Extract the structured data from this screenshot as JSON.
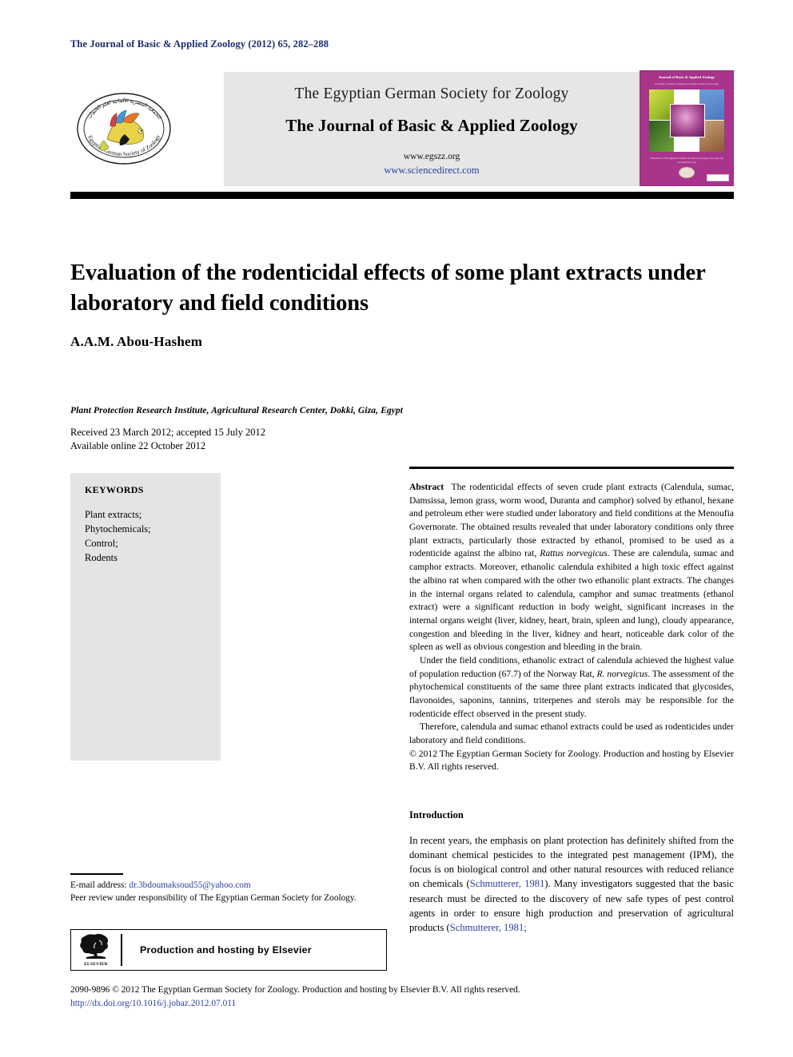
{
  "running_head": "The Journal of Basic & Applied Zoology (2012) 65, 282–288",
  "masthead": {
    "society_name": "The Egyptian German Society for Zoology",
    "journal_name": "The Journal of Basic & Applied Zoology",
    "society_url": "www.egszz.org",
    "sciencedirect_url": "www.sciencedirect.com",
    "seal_alt": "Egyptian German Society of Zoology seal",
    "cover": {
      "title": "Journal of Basic & Applied Zoology",
      "subtitle": "Formerly: Journal of Egyptian German Society of Zoology",
      "footer": "Published by\nThe Egyptian German Society for Zoology\nwww.egsz.org\nwww.elsevier.com"
    }
  },
  "article": {
    "title": "Evaluation of the rodenticidal effects of some plant extracts under laboratory and field conditions",
    "authors": "A.A.M. Abou-Hashem",
    "affiliation": "Plant Protection Research Institute, Agricultural Research Center, Dokki, Giza, Egypt",
    "received": "Received 23 March 2012; accepted 15 July 2012",
    "available": "Available online 22 October 2012"
  },
  "keywords": {
    "heading": "KEYWORDS",
    "items": [
      "Plant extracts;",
      "Phytochemicals;",
      "Control;",
      "Rodents"
    ]
  },
  "abstract": {
    "label": "Abstract",
    "paragraph1_a": "The rodenticidal effects of seven crude plant extracts (Calendula, sumac, Damsissa, lemon grass, worm wood, Duranta and camphor) solved by ethanol, hexane and petroleum ether were studied under laboratory and field conditions at the Menoufia Governorate. The obtained results revealed that under laboratory conditions only three plant extracts, particularly those extracted by ethanol, promised to be used as a rodenticide against the albino rat, ",
    "paragraph1_species": "Rattus norvegicus",
    "paragraph1_b": ". These are calendula, sumac and camphor extracts. Moreover, ethanolic calendula exhibited a high toxic effect against the albino rat when compared with the other two ethanolic plant extracts. The changes in the internal organs related to calendula, camphor and sumac treatments (ethanol extract) were a significant reduction in body weight, significant increases in the internal organs weight (liver, kidney, heart, brain, spleen and lung), cloudy appearance, congestion and bleeding in the liver, kidney and heart, noticeable dark color of the spleen as well as obvious congestion and bleeding in the brain.",
    "paragraph2_a": "Under the field conditions, ethanolic extract of calendula achieved the highest value of population reduction (67.7) of the Norway Rat, ",
    "paragraph2_species": "R. norvegicus",
    "paragraph2_b": ". The assessment of the phytochemical constituents of the same three plant extracts indicated that glycosides, flavonoides, saponins, tannins, triterpenes and sterols may be responsible for the rodenticide effect observed in the present study.",
    "paragraph3": "Therefore, calendula and sumac ethanol extracts could be used as rodenticides under laboratory and field conditions.",
    "copyright": "© 2012 The Egyptian German Society for Zoology. Production and hosting by Elsevier B.V. All rights reserved."
  },
  "introduction": {
    "heading": "Introduction",
    "text_a": "In recent years, the emphasis on plant protection has definitely shifted from the dominant chemical pesticides to the integrated pest management (IPM), the focus is on biological control and other natural resources with reduced reliance on chemicals (",
    "citation1": "Schmutterer, 1981",
    "text_b": "). Many investigators suggested that the basic research must be directed to the discovery of new safe types of pest control agents in order to ensure high production and preservation of agricultural products (",
    "citation2": "Schmutterer, 1981;"
  },
  "footnotes": {
    "email_label": "E-mail address:",
    "email": "dr.3bdoumaksoud55@yahoo.com",
    "peer_review": "Peer review under responsibility of The Egyptian German Society for Zoology.",
    "elsevier_banner": "Production and hosting by Elsevier",
    "elsevier_wordmark": "ELSEVIER"
  },
  "bottom": {
    "issn_line": "2090-9896 © 2012 The Egyptian German Society for Zoology. Production and hosting by Elsevier B.V. All rights reserved.",
    "doi": "http://dx.doi.org/10.1016/j.jobaz.2012.07.011"
  },
  "colors": {
    "running_head": "#1a2b6d",
    "link": "#2b3f9e",
    "banner_bg": "#e6e6e6",
    "keywords_bg": "#e4e4e4",
    "cover_bg": "#a8348c"
  }
}
